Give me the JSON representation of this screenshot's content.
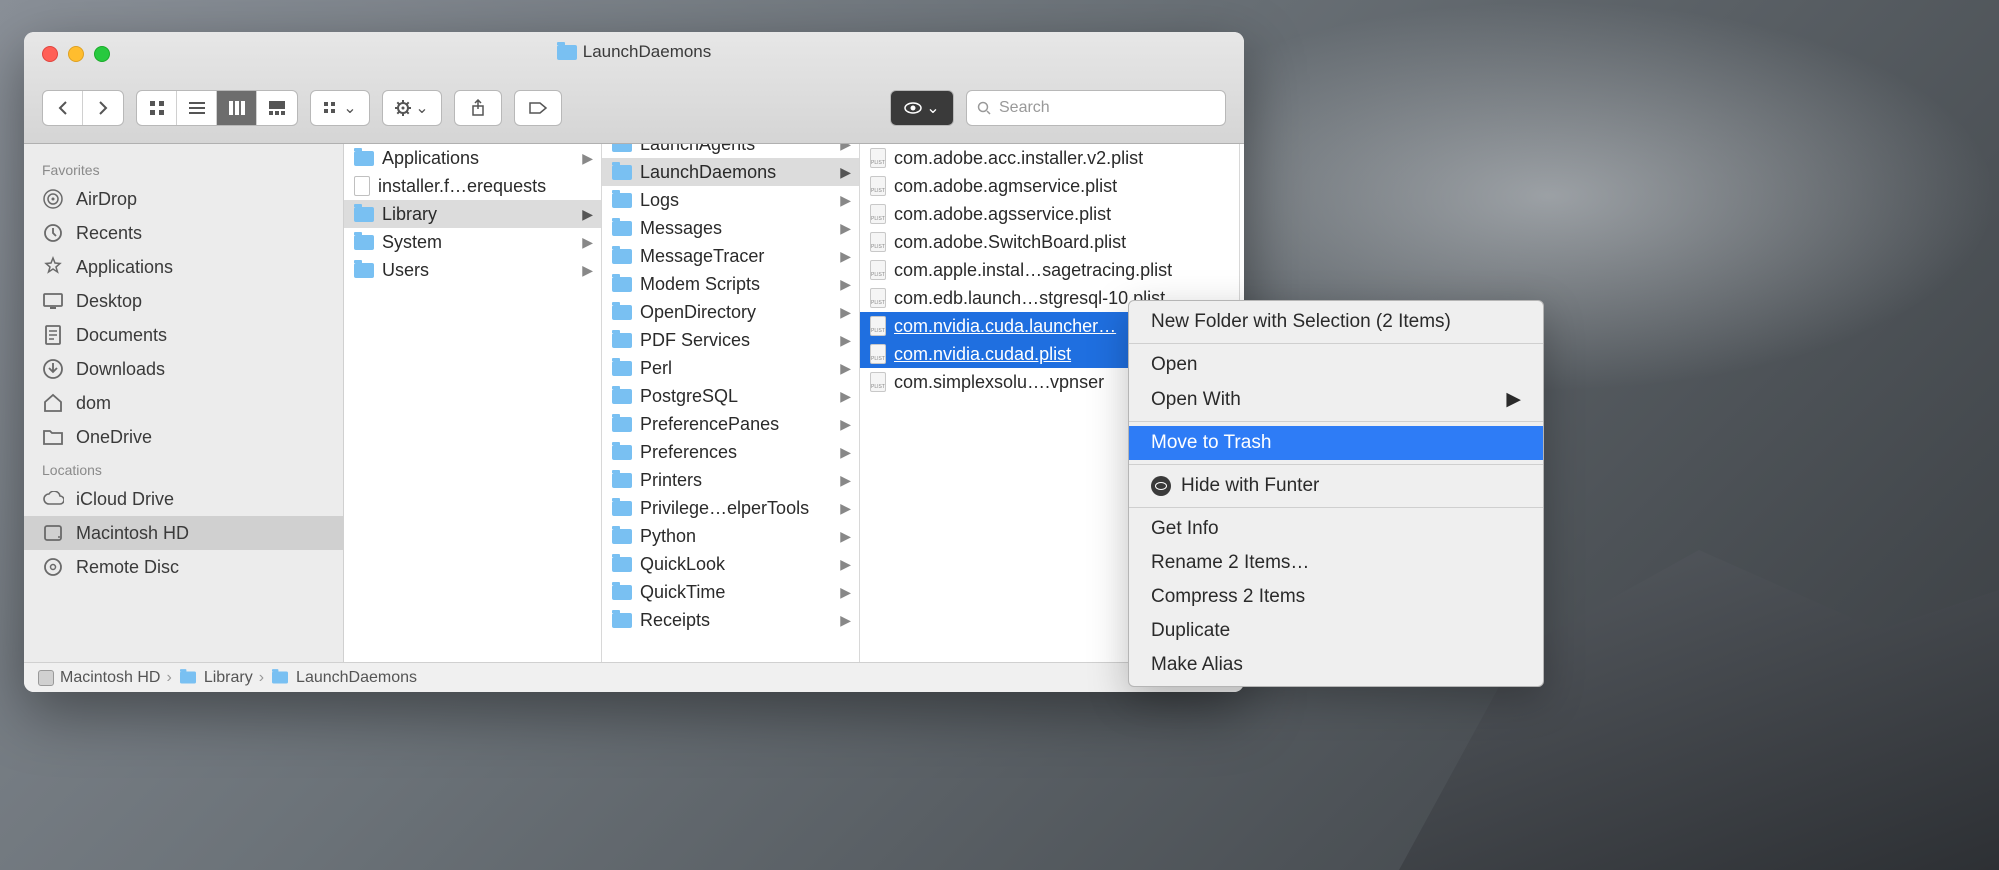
{
  "window": {
    "title": "LaunchDaemons"
  },
  "search": {
    "placeholder": "Search"
  },
  "sidebar": {
    "sections": [
      {
        "header": "Favorites",
        "items": [
          {
            "label": "AirDrop",
            "icon": "airdrop"
          },
          {
            "label": "Recents",
            "icon": "clock"
          },
          {
            "label": "Applications",
            "icon": "apps"
          },
          {
            "label": "Desktop",
            "icon": "desktop"
          },
          {
            "label": "Documents",
            "icon": "docs"
          },
          {
            "label": "Downloads",
            "icon": "downloads"
          },
          {
            "label": "dom",
            "icon": "home"
          },
          {
            "label": "OneDrive",
            "icon": "folder"
          }
        ]
      },
      {
        "header": "Locations",
        "items": [
          {
            "label": "iCloud Drive",
            "icon": "icloud"
          },
          {
            "label": "Macintosh HD",
            "icon": "hd",
            "selected": true
          },
          {
            "label": "Remote Disc",
            "icon": "disc"
          }
        ]
      }
    ]
  },
  "columns": [
    [
      {
        "label": "Applications",
        "type": "folder",
        "chev": true
      },
      {
        "label": "installer.f…erequests",
        "type": "file"
      },
      {
        "label": "Library",
        "type": "folder",
        "chev": true,
        "selected": true
      },
      {
        "label": "System",
        "type": "folder",
        "chev": true
      },
      {
        "label": "Users",
        "type": "folder",
        "chev": true
      }
    ],
    [
      {
        "label": "LaunchAgents",
        "type": "folder",
        "chev": true,
        "cut": true
      },
      {
        "label": "LaunchDaemons",
        "type": "folder",
        "chev": true,
        "selected": true
      },
      {
        "label": "Logs",
        "type": "folder",
        "chev": true
      },
      {
        "label": "Messages",
        "type": "folder",
        "chev": true
      },
      {
        "label": "MessageTracer",
        "type": "folder",
        "chev": true
      },
      {
        "label": "Modem Scripts",
        "type": "folder",
        "chev": true
      },
      {
        "label": "OpenDirectory",
        "type": "folder",
        "chev": true
      },
      {
        "label": "PDF Services",
        "type": "folder",
        "chev": true
      },
      {
        "label": "Perl",
        "type": "folder",
        "chev": true
      },
      {
        "label": "PostgreSQL",
        "type": "folder",
        "chev": true
      },
      {
        "label": "PreferencePanes",
        "type": "folder",
        "chev": true
      },
      {
        "label": "Preferences",
        "type": "folder",
        "chev": true
      },
      {
        "label": "Printers",
        "type": "folder",
        "chev": true
      },
      {
        "label": "Privilege…elperTools",
        "type": "folder",
        "chev": true
      },
      {
        "label": "Python",
        "type": "folder",
        "chev": true
      },
      {
        "label": "QuickLook",
        "type": "folder",
        "chev": true
      },
      {
        "label": "QuickTime",
        "type": "folder",
        "chev": true
      },
      {
        "label": "Receipts",
        "type": "folder",
        "chev": true
      }
    ],
    [
      {
        "label": "com.adobe.acc.installer.v2.plist",
        "type": "plist"
      },
      {
        "label": "com.adobe.agmservice.plist",
        "type": "plist"
      },
      {
        "label": "com.adobe.agsservice.plist",
        "type": "plist"
      },
      {
        "label": "com.adobe.SwitchBoard.plist",
        "type": "plist"
      },
      {
        "label": "com.apple.instal…sagetracing.plist",
        "type": "plist"
      },
      {
        "label": "com.edb.launch…stgresql-10.plist",
        "type": "plist"
      },
      {
        "label": "com.nvidia.cuda.launcher…",
        "type": "plist",
        "filesel": true
      },
      {
        "label": "com.nvidia.cudad.plist",
        "type": "plist",
        "filesel": true
      },
      {
        "label": "com.simplexsolu….vpnser",
        "type": "plist"
      }
    ]
  ],
  "pathbar": [
    "Macintosh HD",
    "Library",
    "LaunchDaemons"
  ],
  "context_menu": [
    {
      "label": "New Folder with Selection (2 Items)"
    },
    {
      "sep": true
    },
    {
      "label": "Open"
    },
    {
      "label": "Open With",
      "submenu": true
    },
    {
      "sep": true
    },
    {
      "label": "Move to Trash",
      "highlight": true
    },
    {
      "sep": true
    },
    {
      "label": "Hide with Funter",
      "icon": "funter"
    },
    {
      "sep": true
    },
    {
      "label": "Get Info"
    },
    {
      "label": "Rename 2 Items…"
    },
    {
      "label": "Compress 2 Items"
    },
    {
      "label": "Duplicate"
    },
    {
      "label": "Make Alias"
    }
  ]
}
